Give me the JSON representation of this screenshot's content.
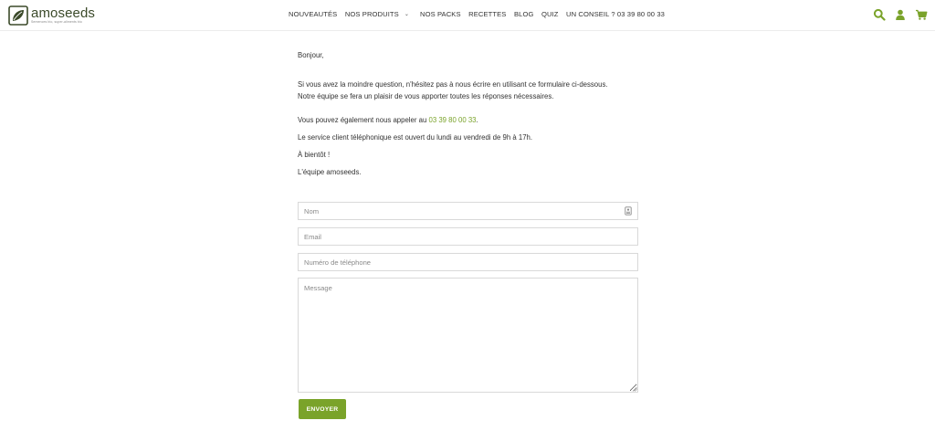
{
  "brand": {
    "name": "amoseeds",
    "tagline": "Semences bio, super-aliments bio",
    "accent_color": "#7aa32a"
  },
  "nav": {
    "items": [
      {
        "label": "NOUVEAUTÉS"
      },
      {
        "label": "NOS PRODUITS",
        "has_dropdown": true
      },
      {
        "label": "NOS PACKS"
      },
      {
        "label": "RECETTES"
      },
      {
        "label": "BLOG"
      },
      {
        "label": "QUIZ"
      },
      {
        "label": "UN CONSEIL ? 03 39 80 00 33"
      }
    ]
  },
  "header_icons": [
    "search-icon",
    "user-icon",
    "cart-icon"
  ],
  "content": {
    "greeting": "Bonjour,",
    "intro_line1": "Si vous avez la moindre question, n'hésitez pas à nous écrire en utilisant ce formulaire ci-dessous.",
    "intro_line2": "Notre équipe se fera un plaisir de vous apporter toutes les réponses nécessaires.",
    "call_prefix": "Vous pouvez également nous appeler au ",
    "phone": "03 39 80 00 33",
    "call_suffix": ".",
    "hours": "Le service client téléphonique est ouvert du lundi au vendredi de 9h à 17h.",
    "bye": "À bientôt !",
    "signature": "L'équipe amoseeds."
  },
  "form": {
    "name_placeholder": "Nom",
    "name_value": "",
    "email_placeholder": "Email",
    "email_value": "",
    "phone_placeholder": "Numéro de téléphone",
    "phone_value": "",
    "message_placeholder": "Message",
    "message_value": "",
    "submit_label": "ENVOYER"
  }
}
